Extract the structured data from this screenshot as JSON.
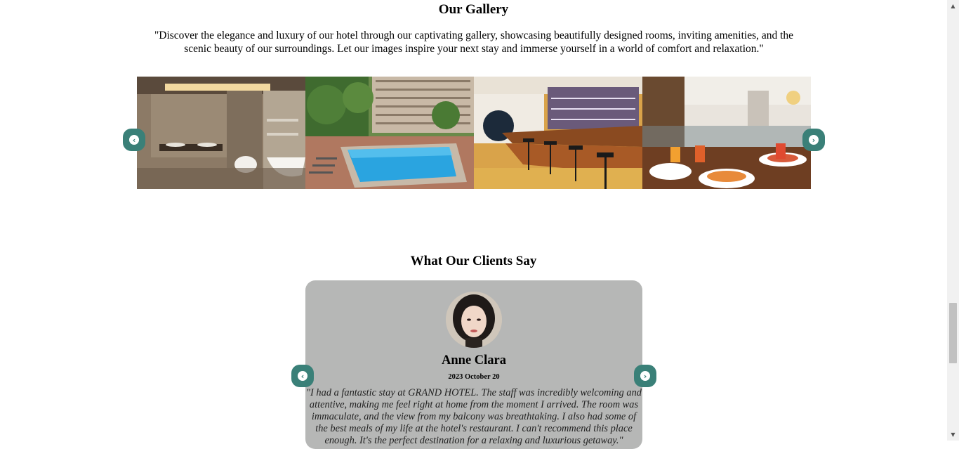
{
  "gallery": {
    "title": "Our Gallery",
    "description": "\"Discover the elegance and luxury of our hotel through our captivating gallery, showcasing beautifully designed rooms, inviting amenities, and the scenic beauty of our surroundings. Let our images inspire your next stay and immerse yourself in a world of comfort and relaxation.\"",
    "prev_icon": "chevron-left-circle-icon",
    "next_icon": "chevron-right-circle-icon",
    "prev_glyph": "‹",
    "next_glyph": "›"
  },
  "testimonials": {
    "title": "What Our Clients Say",
    "name": "Anne Clara",
    "date": "2023 October 20",
    "quote": "\"I had a fantastic stay at GRAND HOTEL. The staff was incredibly welcoming and attentive, making me feel right at home from the moment I arrived. The room was immaculate, and the view from my balcony was breathtaking. I also had some of the best meals of my life at the hotel's restaurant. I can't recommend this place enough. It's the perfect destination for a relaxing and luxurious getaway.\"",
    "prev_glyph": "‹",
    "next_glyph": "›"
  },
  "colors": {
    "accent": "#3a8078",
    "card_bg": "#b6b7b6"
  }
}
